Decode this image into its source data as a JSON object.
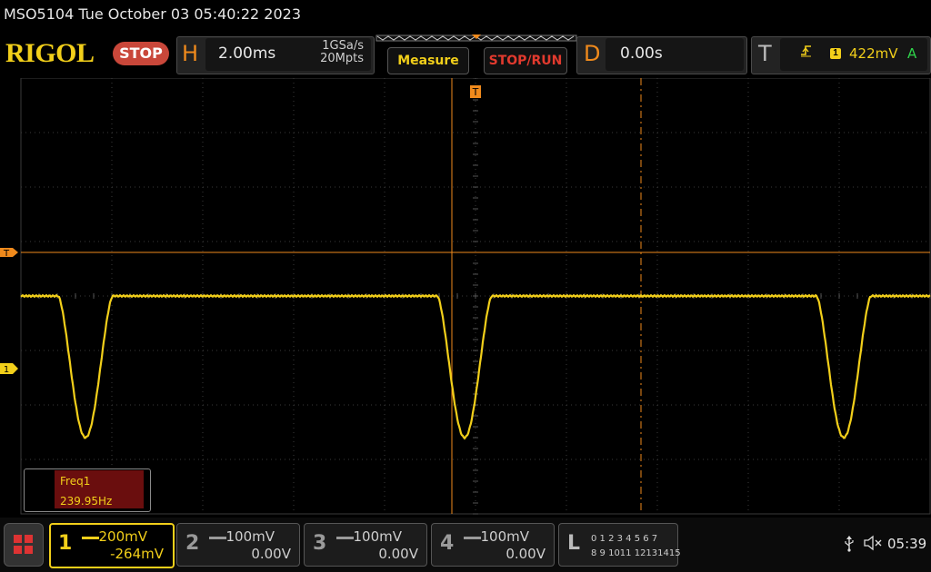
{
  "title_bar": {
    "text": "MSO5104  Tue October 03 05:40:22 2023"
  },
  "brand": {
    "logo": "RIGOL",
    "run_state": "STOP"
  },
  "horizontal": {
    "letter": "H",
    "timebase": "2.00ms",
    "sample_rate": "1GSa/s",
    "memory_depth": "20Mpts"
  },
  "buttons": {
    "measure": "Measure",
    "stop_run": "STOP/RUN"
  },
  "delay": {
    "letter": "D",
    "value": "0.00s"
  },
  "trigger": {
    "letter": "T",
    "edge_icon": "rising-edge-icon",
    "source": "1",
    "level": "422mV",
    "mode": "A"
  },
  "markers": {
    "trigger_level": "T",
    "channel1": "1",
    "trigger_position": "T"
  },
  "measurement": {
    "name": "Freq1",
    "value": "239.95Hz"
  },
  "channels": [
    {
      "number": "1",
      "scale": "200mV",
      "offset": "-264mV",
      "color": "#f2cf1a",
      "active": true
    },
    {
      "number": "2",
      "scale": "100mV",
      "offset": "0.00V",
      "color": "#9a9a9a",
      "active": false
    },
    {
      "number": "3",
      "scale": "100mV",
      "offset": "0.00V",
      "color": "#9a9a9a",
      "active": false
    },
    {
      "number": "4",
      "scale": "100mV",
      "offset": "0.00V",
      "color": "#9a9a9a",
      "active": false
    }
  ],
  "logic": {
    "letter": "L",
    "row1": "0 1 2 3   4 5 6 7",
    "row2": "8 9 1011 12131415"
  },
  "status": {
    "usb_icon": "usb-icon",
    "speaker_icon": "speaker-muted-icon",
    "time": "05:39"
  },
  "colors": {
    "channel1": "#f2cf1a",
    "trigger": "#f08a1c",
    "stop": "#c9473a"
  },
  "waveform": {
    "period_divisions": 4.17,
    "high_div": 4.0,
    "low_div": 1.4
  }
}
